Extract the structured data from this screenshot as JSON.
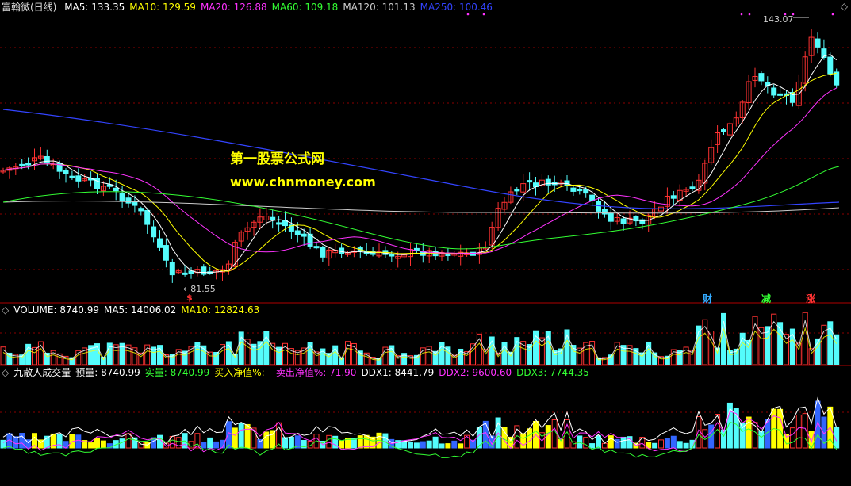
{
  "title": "富翰微(日线)",
  "main_indicators": [
    {
      "label": "MA5: 133.35",
      "color": "#ffffff"
    },
    {
      "label": "MA10: 129.59",
      "color": "#ffff00"
    },
    {
      "label": "MA20: 126.88",
      "color": "#ff33ff"
    },
    {
      "label": "MA60: 109.18",
      "color": "#33ff33"
    },
    {
      "label": "MA120: 101.13",
      "color": "#cccccc"
    },
    {
      "label": "MA250: 100.46",
      "color": "#3344ff"
    }
  ],
  "high_label": "143.07",
  "low_label": "81.55",
  "watermark_line1": "第一股票公式网",
  "watermark_line2": "www.chnmoney.com",
  "signals": [
    {
      "text": "财",
      "color": "#33aaff"
    },
    {
      "text": "减",
      "color": "#33ff33"
    },
    {
      "text": "涨",
      "color": "#ff3333"
    }
  ],
  "s_marker": "$",
  "volume_indicators": [
    {
      "label": "VOLUME: 8740.99",
      "color": "#ffffff"
    },
    {
      "label": "MA5: 14006.02",
      "color": "#ffffff"
    },
    {
      "label": "MA10: 12824.63",
      "color": "#ffff00"
    }
  ],
  "ddx_indicators": [
    {
      "label": "九散人成交量",
      "color": "#ffffff"
    },
    {
      "label": "预量: 8740.99",
      "color": "#ffffff"
    },
    {
      "label": "实量: 8740.99",
      "color": "#33ff33"
    },
    {
      "label": "买入净值%: -",
      "color": "#ffff00"
    },
    {
      "label": "卖出净值%: 71.90",
      "color": "#ff33ff"
    },
    {
      "label": "DDX1: 8441.79",
      "color": "#ffffff"
    },
    {
      "label": "DDX2: 9600.60",
      "color": "#ff33ff"
    },
    {
      "label": "DDX3: 7744.35",
      "color": "#33ff33"
    }
  ],
  "icons": {
    "toggle": "diamond-icon"
  },
  "colors": {
    "up": "#ff3232",
    "down": "#54fcfc",
    "grid": "#8b0000",
    "divider": "#b00000"
  }
}
